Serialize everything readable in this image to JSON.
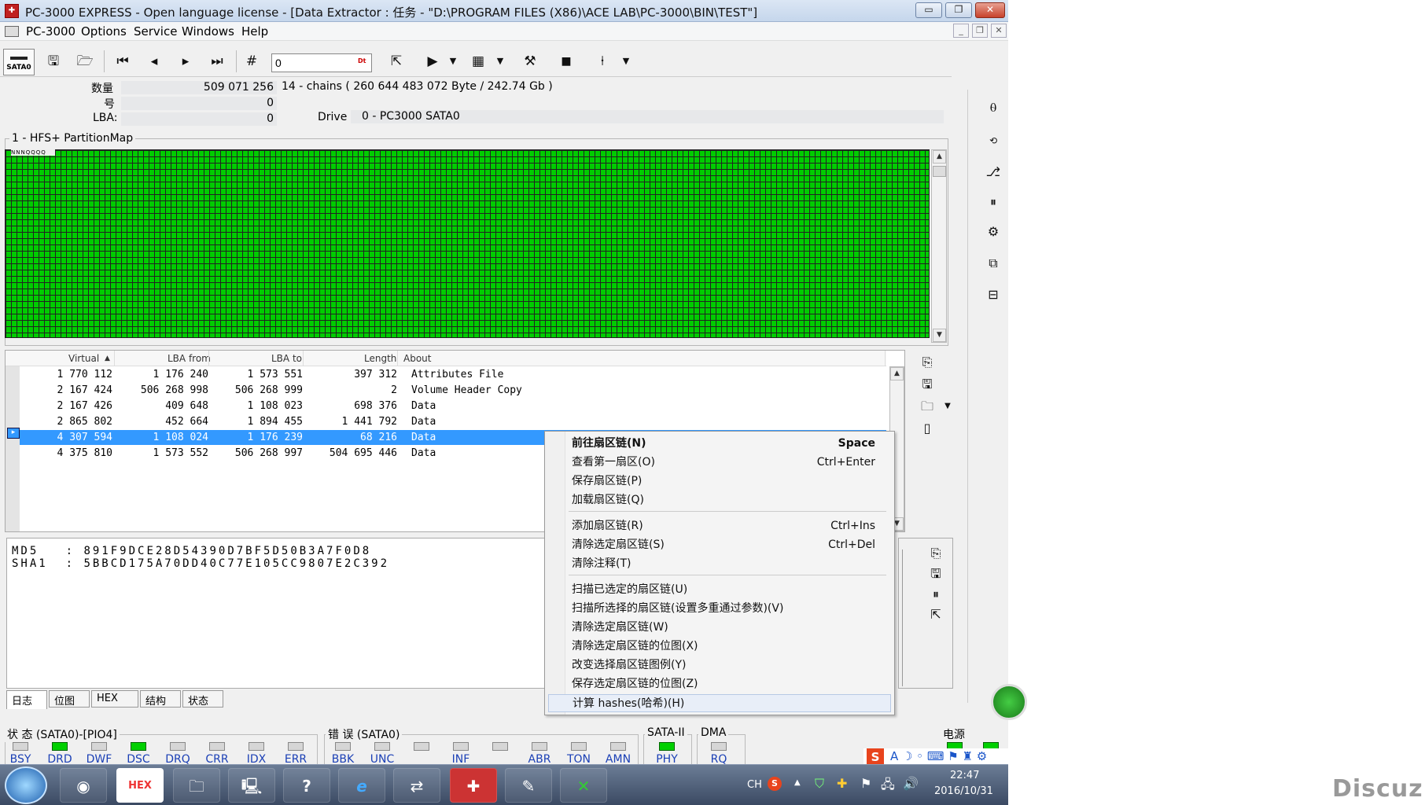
{
  "title_bar": {
    "text": "PC-3000 EXPRESS - Open language license - [Data Extractor : 任务 - \"D:\\PROGRAM FILES (X86)\\ACE LAB\\PC-3000\\BIN\\TEST\"]",
    "minimize": "▭",
    "restore": "❐",
    "close": "✕"
  },
  "menu": {
    "items": [
      "PC-3000",
      "Options",
      "Service",
      "Windows",
      "Help"
    ],
    "mdi_min": "_",
    "mdi_restore": "❐",
    "mdi_close": "✕"
  },
  "toolbar": {
    "device_label": "SATA0",
    "lba_value": "0",
    "lba_tag": "Dt"
  },
  "info": {
    "count_label": "数量",
    "count_value": "509 071 256",
    "chains_text": "14 - chains  ( 260 644 483 072 Byte /  242.74 Gb )",
    "num_label": "号",
    "num_value": "0",
    "lba_label": "LBA:",
    "lba_value": "0",
    "drive_label": "Drive",
    "drive_value": "0 - PC3000 SATA0"
  },
  "map": {
    "title": "1 - HFS+ PartitionMap",
    "head_marks": "NNNQQQQ"
  },
  "table": {
    "columns": [
      "Virtual",
      "LBA from",
      "LBA to",
      "Length",
      "About"
    ],
    "rows": [
      {
        "virtual": "1 770 112",
        "from": "1 176 240",
        "to": "1 573 551",
        "length": "397 312",
        "about": "Attributes File",
        "selected": false
      },
      {
        "virtual": "2 167 424",
        "from": "506 268 998",
        "to": "506 268 999",
        "length": "2",
        "about": "Volume Header Copy",
        "selected": false
      },
      {
        "virtual": "2 167 426",
        "from": "409 648",
        "to": "1 108 023",
        "length": "698 376",
        "about": "Data",
        "selected": false
      },
      {
        "virtual": "2 865 802",
        "from": "452 664",
        "to": "1 894 455",
        "length": "1 441 792",
        "about": "Data",
        "selected": false
      },
      {
        "virtual": "4 307 594",
        "from": "1 108 024",
        "to": "1 176 239",
        "length": "68 216",
        "about": "Data",
        "selected": true
      },
      {
        "virtual": "4 375 810",
        "from": "1 573 552",
        "to": "506 268 997",
        "length": "504 695 446",
        "about": "Data",
        "selected": false
      }
    ]
  },
  "hashes": {
    "md5_label": "MD5   :",
    "md5_value": "891F9DCE28D54390D7BF5D50B3A7F0D8",
    "sha1_label": "SHA1  :",
    "sha1_value": "5BBCD175A70DD40C77E105CC9807E2C392"
  },
  "tabs": [
    "日志",
    "位图",
    "HEX",
    "结构",
    "状态"
  ],
  "context_menu": {
    "items": [
      {
        "label": "前往扇区链(N)",
        "shortcut": "Space",
        "bold": true
      },
      {
        "label": "查看第一扇区(O)",
        "shortcut": "Ctrl+Enter"
      },
      {
        "label": "保存扇区链(P)",
        "shortcut": ""
      },
      {
        "label": "加载扇区链(Q)",
        "shortcut": ""
      },
      {
        "label": "添加扇区链(R)",
        "shortcut": "Ctrl+Ins"
      },
      {
        "label": "清除选定扇区链(S)",
        "shortcut": "Ctrl+Del"
      },
      {
        "label": "清除注释(T)",
        "shortcut": ""
      },
      {
        "label": "扫描已选定的扇区链(U)",
        "shortcut": ""
      },
      {
        "label": "扫描所选择的扇区链(设置多重通过参数)(V)",
        "shortcut": ""
      },
      {
        "label": "清除选定扇区链(W)",
        "shortcut": ""
      },
      {
        "label": "清除选定扇区链的位图(X)",
        "shortcut": ""
      },
      {
        "label": "改变选择扇区链图例(Y)",
        "shortcut": ""
      },
      {
        "label": "保存选定扇区链的位图(Z)",
        "shortcut": ""
      },
      {
        "label": "计算 hashes(哈希)(H)",
        "shortcut": ""
      }
    ]
  },
  "status": {
    "state_title": "状 态 (SATA0)-[PIO4]",
    "state_leds": [
      {
        "label": "BSY",
        "on": false
      },
      {
        "label": "DRD",
        "on": true
      },
      {
        "label": "DWF",
        "on": false
      },
      {
        "label": "DSC",
        "on": true
      },
      {
        "label": "DRQ",
        "on": false
      },
      {
        "label": "CRR",
        "on": false
      },
      {
        "label": "IDX",
        "on": false
      },
      {
        "label": "ERR",
        "on": false
      }
    ],
    "error_title": "错 误 (SATA0)",
    "error_leds": [
      {
        "label": "BBK",
        "on": false
      },
      {
        "label": "UNC",
        "on": false
      },
      {
        "label": "",
        "on": false
      },
      {
        "label": "INF",
        "on": false
      },
      {
        "label": "",
        "on": false
      },
      {
        "label": "ABR",
        "on": false
      },
      {
        "label": "TON",
        "on": false
      },
      {
        "label": "AMN",
        "on": false
      }
    ],
    "sata_title": "SATA-II",
    "sata_led": {
      "label": "PHY",
      "on": true
    },
    "dma_title": "DMA",
    "dma_led": {
      "label": "RQ",
      "on": false
    },
    "power_title": "电源"
  },
  "taskbar": {
    "lang": "CH",
    "time": "22:47",
    "date": "2016/10/31"
  },
  "watermark": "Discuz!"
}
